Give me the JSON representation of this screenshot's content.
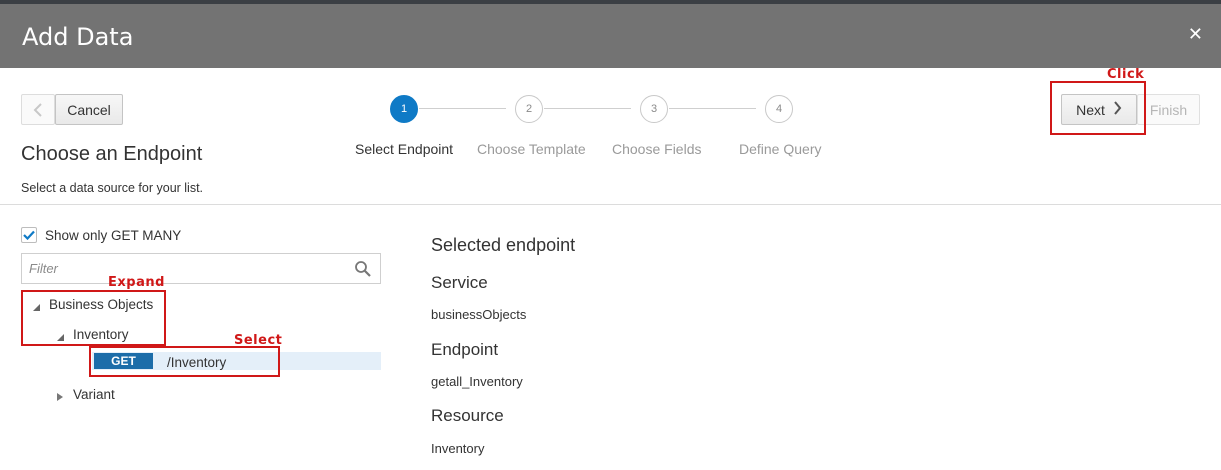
{
  "dialog": {
    "title": "Add Data",
    "close_glyph": "✕"
  },
  "toolbar": {
    "back_glyph": "‹",
    "cancel_label": "Cancel",
    "next_label": "Next",
    "finish_label": "Finish"
  },
  "train": {
    "steps": [
      {
        "number": "1",
        "label": "Select Endpoint"
      },
      {
        "number": "2",
        "label": "Choose Template"
      },
      {
        "number": "3",
        "label": "Choose Fields"
      },
      {
        "number": "4",
        "label": "Define Query"
      }
    ],
    "active_step": 1
  },
  "left": {
    "heading": "Choose an Endpoint",
    "subtitle": "Select a data source for your list.",
    "show_only_get_many_label": "Show only GET MANY",
    "show_only_get_many_checked": true,
    "filter_placeholder": "Filter",
    "tree": {
      "business_objects": "Business Objects",
      "inventory": "Inventory",
      "get_method": "GET",
      "get_path": "/Inventory",
      "variant": "Variant"
    }
  },
  "right": {
    "title": "Selected endpoint",
    "service_label": "Service",
    "service_value": "businessObjects",
    "endpoint_label": "Endpoint",
    "endpoint_value": "getall_Inventory",
    "resource_label": "Resource",
    "resource_value": "Inventory"
  },
  "annotations": {
    "click": "Click",
    "expand": "Expand",
    "select": "Select"
  },
  "colors": {
    "header_bg": "#737373",
    "accent_blue": "#0f7ac6",
    "get_badge": "#1c6da9",
    "selection_bg": "#e4eff9",
    "annotation_red": "#d01818"
  }
}
